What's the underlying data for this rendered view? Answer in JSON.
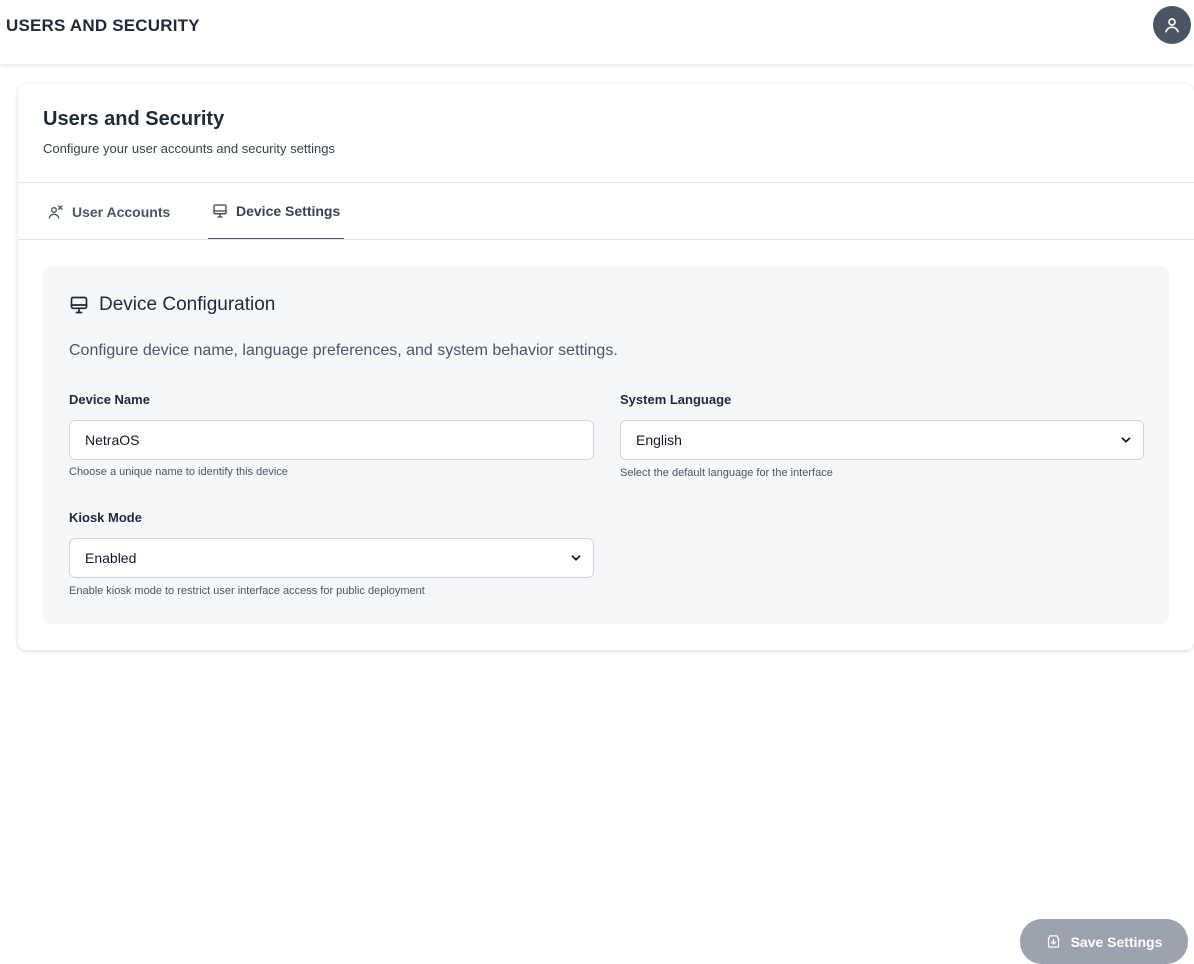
{
  "header": {
    "title": "USERS AND SECURITY",
    "avatar_icon": "user-icon"
  },
  "page": {
    "title": "Users and Security",
    "subtitle": "Configure your user accounts and security settings"
  },
  "tabs": [
    {
      "label": "User Accounts",
      "icon": "users-icon",
      "active": false
    },
    {
      "label": "Device Settings",
      "icon": "monitor-icon",
      "active": true
    }
  ],
  "device_config": {
    "heading": "Device Configuration",
    "heading_icon": "monitor-icon",
    "description": "Configure device name, language preferences, and system behavior settings.",
    "device_name": {
      "label": "Device Name",
      "value": "NetraOS",
      "help": "Choose a unique name to identify this device"
    },
    "system_language": {
      "label": "System Language",
      "selected": "English",
      "help": "Select the default language for the interface"
    },
    "kiosk_mode": {
      "label": "Kiosk Mode",
      "selected": "Enabled",
      "help": "Enable kiosk mode to restrict user interface access for public deployment"
    }
  },
  "actions": {
    "save_label": "Save Settings",
    "save_icon": "save-icon"
  },
  "colors": {
    "avatar_bg": "#4b5563",
    "panel_bg": "#f6f7f9",
    "save_button_bg": "#9ca3af",
    "active_tab_underline": "#4b5563"
  }
}
